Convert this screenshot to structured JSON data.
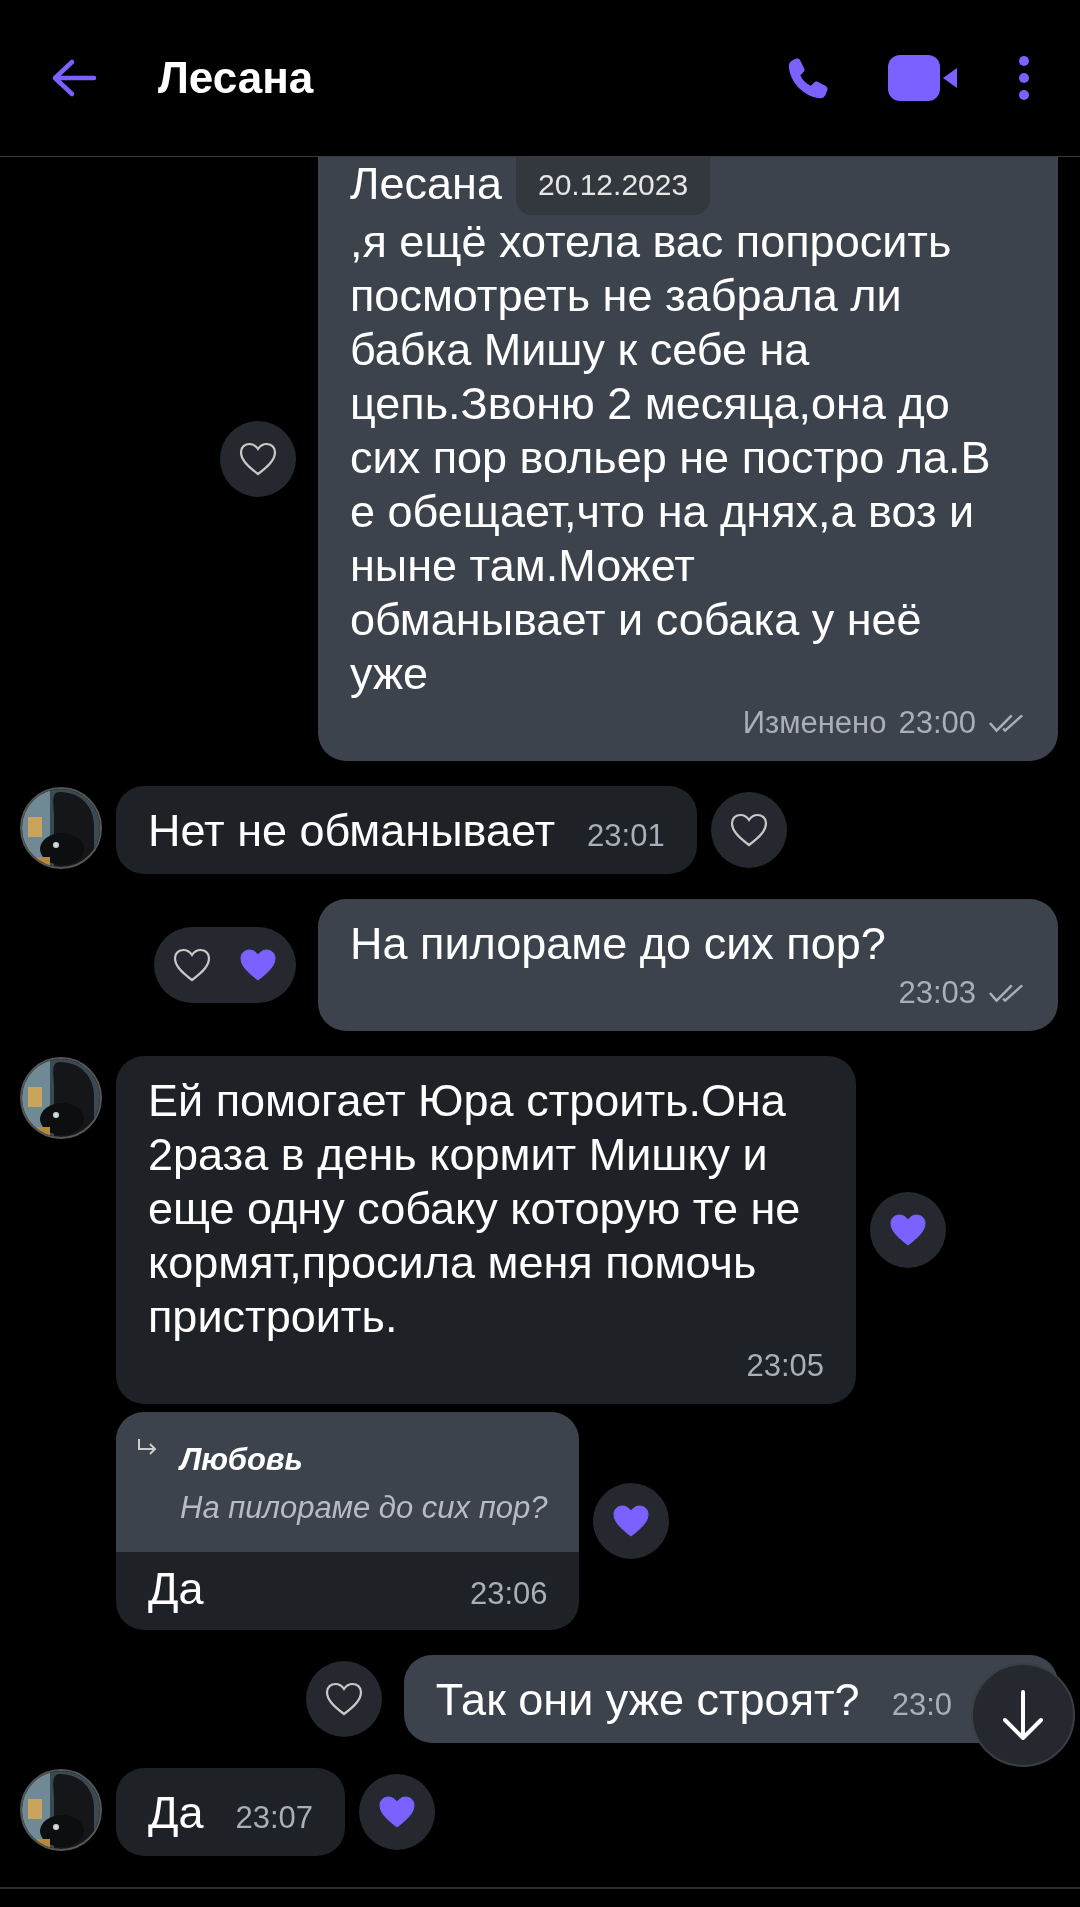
{
  "header": {
    "title": "Лесана"
  },
  "date_badge": "20.12.2023",
  "messages": [
    {
      "kind": "outgoing",
      "header_line": "Лесана",
      "text": ",я ещё хотела вас попросить\nпосмотреть не забрала ли\nбабка Мишу к себе на\nцепь.Звоню 2 месяца,она до\nсих пор вольер не постро ла.В\nе обещает,что на днях,а воз и\nныне там.Может\nобманывает и собака у неё\nуже",
      "edited": "Изменено",
      "time": "23:00",
      "read": true,
      "reactions": [
        {
          "liked": false
        }
      ]
    },
    {
      "kind": "incoming",
      "show_avatar": true,
      "text": "Нет не обманывает",
      "time": "23:01",
      "reactions": [
        {
          "liked": false
        }
      ]
    },
    {
      "kind": "outgoing",
      "text": "На пилораме до сих пор?",
      "time": "23:03",
      "read": true,
      "reactions": [
        {
          "liked": false
        },
        {
          "liked": true
        }
      ]
    },
    {
      "kind": "incoming",
      "show_avatar": true,
      "text": "Ей помогает Юра строить.Она\n2раза в день кормит Мишку и\nеще одну собаку которую те не\nкормят,просила меня помочь\nпристроить.",
      "time": "23:05",
      "reactions": [
        {
          "liked": true
        }
      ]
    },
    {
      "kind": "incoming",
      "show_avatar": false,
      "reply": {
        "author": "Любовь",
        "text": "На пилораме до сих пор?"
      },
      "text": "Да",
      "time": "23:06",
      "reactions": [
        {
          "liked": true
        }
      ]
    },
    {
      "kind": "outgoing",
      "text": "Так они уже строят?",
      "time": "23:0",
      "reactions": [
        {
          "liked": false
        }
      ]
    },
    {
      "kind": "incoming",
      "show_avatar": true,
      "text": "Да",
      "time": "23:07",
      "reactions": [
        {
          "liked": true
        }
      ]
    }
  ]
}
